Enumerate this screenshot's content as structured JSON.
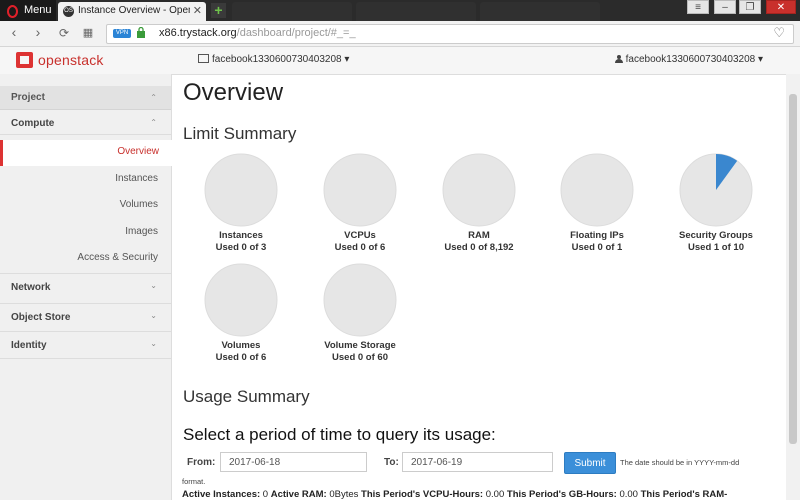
{
  "browser": {
    "menu_label": "Menu",
    "tab_title": "Instance Overview - Opens",
    "favicon_text": "OS",
    "new_tab": "+",
    "url_host": "x86.trystack.org",
    "url_path": "/dashboard/project/#_=_",
    "vpn_badge": "VPN"
  },
  "header": {
    "brand": "openstack",
    "project_selector": "facebook1330600730403208 ▾",
    "user_menu": "facebook1330600730403208 ▾"
  },
  "sidebar": {
    "project": "Project",
    "compute": "Compute",
    "compute_items": [
      "Overview",
      "Instances",
      "Volumes",
      "Images",
      "Access & Security"
    ],
    "sections": [
      "Network",
      "Object Store",
      "Identity"
    ],
    "chevron_up": "⌃",
    "chevron_down": "⌄"
  },
  "main": {
    "title": "Overview",
    "limit_summary": "Limit Summary",
    "limits": [
      {
        "name": "Instances",
        "usage": "Used 0 of 3",
        "used": 0,
        "total": 3
      },
      {
        "name": "VCPUs",
        "usage": "Used 0 of 6",
        "used": 0,
        "total": 6
      },
      {
        "name": "RAM",
        "usage": "Used 0 of 8,192",
        "used": 0,
        "total": 8192
      },
      {
        "name": "Floating IPs",
        "usage": "Used 0 of 1",
        "used": 0,
        "total": 1
      },
      {
        "name": "Security Groups",
        "usage": "Used 1 of 10",
        "used": 1,
        "total": 10
      },
      {
        "name": "Volumes",
        "usage": "Used 0 of 6",
        "used": 0,
        "total": 6
      },
      {
        "name": "Volume Storage",
        "usage": "Used 0 of 60",
        "used": 0,
        "total": 60
      }
    ],
    "usage_summary": "Usage Summary",
    "query_heading": "Select a period of time to query its usage:",
    "from_label": "From:",
    "from_value": "2017-06-18",
    "to_label": "To:",
    "to_value": "2017-06-19",
    "submit_label": "Submit",
    "date_hint": "The date should be in YYYY-mm-dd",
    "format_word": "format.",
    "usage_line": {
      "active_instances_label": "Active Instances:",
      "active_instances_value": "0",
      "active_ram_label": "Active RAM:",
      "active_ram_value": "0Bytes",
      "vcpu_label": "This Period's VCPU-Hours:",
      "vcpu_value": "0.00",
      "gb_label": "This Period's GB-Hours:",
      "gb_value": "0.00",
      "ram_label": "This Period's RAM-"
    }
  },
  "colors": {
    "accent": "#d33a2f",
    "pie_fill": "#e6e6e6",
    "pie_used": "#3a87cf",
    "submit": "#3b8fd9"
  }
}
